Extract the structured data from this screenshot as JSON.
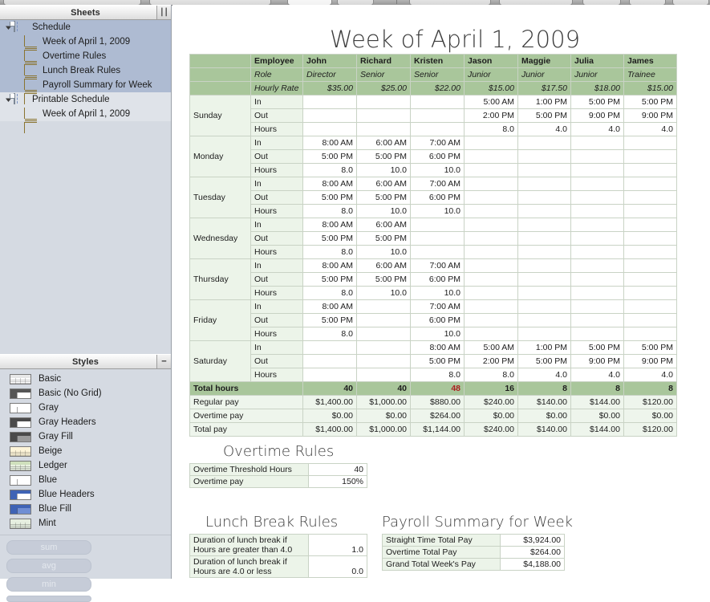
{
  "window": {
    "toolbar_visible": true
  },
  "sidebar": {
    "sheets_pane": {
      "title": "Sheets",
      "grip_icon": "resize-grip-icon",
      "groups": [
        {
          "label": "Schedule",
          "icon": "sheet-document-icon",
          "selected": true,
          "expanded": true,
          "children": [
            {
              "label": "Week of April 1, 2009",
              "icon": "table-icon"
            },
            {
              "label": "Overtime Rules",
              "icon": "table-icon"
            },
            {
              "label": "Lunch Break Rules",
              "icon": "table-icon"
            },
            {
              "label": "Payroll Summary for Week",
              "icon": "table-icon"
            }
          ]
        },
        {
          "label": "Printable Schedule",
          "icon": "sheet-document-icon",
          "selected": false,
          "expanded": true,
          "children": [
            {
              "label": "Week of April 1, 2009",
              "icon": "table-icon"
            }
          ]
        }
      ]
    },
    "styles_pane": {
      "title": "Styles",
      "grip_icon": "resize-grip-icon",
      "items": [
        {
          "label": "Basic",
          "swatch": "#ffffff",
          "header": "#e8e8e8",
          "grid": true
        },
        {
          "label": "Basic (No Grid)",
          "swatch": "#ffffff",
          "header": "#555555",
          "grid": false
        },
        {
          "label": "Gray",
          "swatch": "#ffffff",
          "header": "#ffffff",
          "grid": false
        },
        {
          "label": "Gray Headers",
          "swatch": "#ffffff",
          "header": "#4a4a4a",
          "grid": false
        },
        {
          "label": "Gray Fill",
          "swatch": "#9a9a9a",
          "header": "#4a4a4a",
          "grid": false
        },
        {
          "label": "Beige",
          "swatch": "#fdf4d8",
          "header": "#fdf4d8",
          "grid": true
        },
        {
          "label": "Ledger",
          "swatch": "#e8f0e0",
          "header": "#cfe0bc",
          "grid": true
        },
        {
          "label": "Blue",
          "swatch": "#ffffff",
          "header": "#ffffff",
          "grid": false
        },
        {
          "label": "Blue Headers",
          "swatch": "#ffffff",
          "header": "#3f63b5",
          "grid": false
        },
        {
          "label": "Blue Fill",
          "swatch": "#6f8ed4",
          "header": "#3f63b5",
          "grid": false
        },
        {
          "label": "Mint",
          "swatch": "#e6efe0",
          "header": "#e6efe0",
          "grid": true
        }
      ],
      "function_buttons": [
        "sum",
        "avg",
        "min"
      ]
    }
  },
  "canvas": {
    "schedule": {
      "title": "Week of April 1, 2009",
      "employees": [
        "John",
        "Richard",
        "Kristen",
        "Jason",
        "Maggie",
        "Julia",
        "James"
      ],
      "header_row_label": "Employee",
      "role_label": "Role",
      "roles": [
        "Director",
        "Senior",
        "Senior",
        "Junior",
        "Junior",
        "Junior",
        "Trainee"
      ],
      "rate_label": "Hourly Rate",
      "rates": [
        "$35.00",
        "$25.00",
        "$22.00",
        "$15.00",
        "$17.50",
        "$18.00",
        "$15.00"
      ],
      "sub_labels": [
        "In",
        "Out",
        "Hours"
      ],
      "days": [
        {
          "name": "Sunday",
          "in": [
            "",
            "",
            "",
            "5:00 AM",
            "1:00 PM",
            "5:00 PM",
            "5:00 PM"
          ],
          "out": [
            "",
            "",
            "",
            "2:00 PM",
            "5:00 PM",
            "9:00 PM",
            "9:00 PM"
          ],
          "hours": [
            "",
            "",
            "",
            "8.0",
            "4.0",
            "4.0",
            "4.0"
          ]
        },
        {
          "name": "Monday",
          "in": [
            "8:00 AM",
            "6:00 AM",
            "7:00 AM",
            "",
            "",
            "",
            ""
          ],
          "out": [
            "5:00 PM",
            "5:00 PM",
            "6:00 PM",
            "",
            "",
            "",
            ""
          ],
          "hours": [
            "8.0",
            "10.0",
            "10.0",
            "",
            "",
            "",
            ""
          ]
        },
        {
          "name": "Tuesday",
          "in": [
            "8:00 AM",
            "6:00 AM",
            "7:00 AM",
            "",
            "",
            "",
            ""
          ],
          "out": [
            "5:00 PM",
            "5:00 PM",
            "6:00 PM",
            "",
            "",
            "",
            ""
          ],
          "hours": [
            "8.0",
            "10.0",
            "10.0",
            "",
            "",
            "",
            ""
          ]
        },
        {
          "name": "Wednesday",
          "in": [
            "8:00 AM",
            "6:00 AM",
            "",
            "",
            "",
            "",
            ""
          ],
          "out": [
            "5:00 PM",
            "5:00 PM",
            "",
            "",
            "",
            "",
            ""
          ],
          "hours": [
            "8.0",
            "10.0",
            "",
            "",
            "",
            "",
            ""
          ]
        },
        {
          "name": "Thursday",
          "in": [
            "8:00 AM",
            "6:00 AM",
            "7:00 AM",
            "",
            "",
            "",
            ""
          ],
          "out": [
            "5:00 PM",
            "5:00 PM",
            "6:00 PM",
            "",
            "",
            "",
            ""
          ],
          "hours": [
            "8.0",
            "10.0",
            "10.0",
            "",
            "",
            "",
            ""
          ]
        },
        {
          "name": "Friday",
          "in": [
            "8:00 AM",
            "",
            "7:00 AM",
            "",
            "",
            "",
            ""
          ],
          "out": [
            "5:00 PM",
            "",
            "6:00 PM",
            "",
            "",
            "",
            ""
          ],
          "hours": [
            "8.0",
            "",
            "10.0",
            "",
            "",
            "",
            ""
          ]
        },
        {
          "name": "Saturday",
          "in": [
            "",
            "",
            "8:00 AM",
            "5:00 AM",
            "1:00 PM",
            "5:00 PM",
            "5:00 PM"
          ],
          "out": [
            "",
            "",
            "5:00 PM",
            "2:00 PM",
            "5:00 PM",
            "9:00 PM",
            "9:00 PM"
          ],
          "hours": [
            "",
            "",
            "8.0",
            "8.0",
            "4.0",
            "4.0",
            "4.0"
          ]
        }
      ],
      "totals": [
        {
          "label": "Total hours",
          "style": "header",
          "values": [
            "40",
            "40",
            "48",
            "16",
            "8",
            "8",
            "8"
          ],
          "highlight_index": 2,
          "highlight_color": "#ab1f1f"
        },
        {
          "label": "Regular pay",
          "style": "alt",
          "values": [
            "$1,400.00",
            "$1,000.00",
            "$880.00",
            "$240.00",
            "$140.00",
            "$144.00",
            "$120.00"
          ]
        },
        {
          "label": "Overtime pay",
          "style": "alt",
          "values": [
            "$0.00",
            "$0.00",
            "$264.00",
            "$0.00",
            "$0.00",
            "$0.00",
            "$0.00"
          ]
        },
        {
          "label": "Total pay",
          "style": "alt",
          "values": [
            "$1,400.00",
            "$1,000.00",
            "$1,144.00",
            "$240.00",
            "$140.00",
            "$144.00",
            "$120.00"
          ]
        }
      ]
    },
    "overtime_rules": {
      "title": "Overtime Rules",
      "rows": [
        {
          "key": "Overtime Threshold Hours",
          "value": "40"
        },
        {
          "key": "Overtime pay",
          "value": "150%"
        }
      ]
    },
    "lunch_break_rules": {
      "title": "Lunch Break Rules",
      "rows": [
        {
          "key": "Duration of lunch break if Hours are greater than 4.0",
          "value": "1.0"
        },
        {
          "key": "Duration of lunch break if Hours are 4.0 or less",
          "value": "0.0"
        }
      ]
    },
    "payroll_summary": {
      "title": "Payroll Summary for Week",
      "rows": [
        {
          "key": "Straight Time Total Pay",
          "value": "$3,924.00"
        },
        {
          "key": "Overtime Total Pay",
          "value": "$264.00"
        },
        {
          "key": "Grand Total Week's Pay",
          "value": "$4,188.00"
        }
      ]
    }
  },
  "colors": {
    "header_green": "#a9c69b",
    "light_green": "#ecf4e9",
    "grid_line": "#c9d3c5",
    "sidebar_bg": "#d5dae2",
    "selection_blue": "#aebbd2",
    "alert_red": "#ab1f1f"
  }
}
